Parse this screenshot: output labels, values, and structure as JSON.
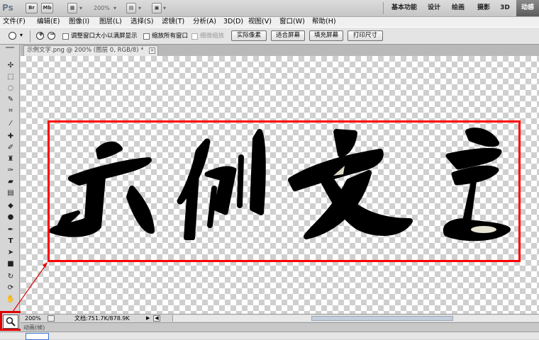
{
  "appbar": {
    "logo": "Ps",
    "br_label": "Br",
    "mb_label": "Mb",
    "zoom_value": "200%",
    "workspaces": [
      "基本功能",
      "设计",
      "绘画",
      "摄影",
      "3D",
      "动感"
    ],
    "active_workspace": "动感"
  },
  "menubar": {
    "items": [
      "文件(F)",
      "编辑(E)",
      "图像(I)",
      "图层(L)",
      "选择(S)",
      "滤镜(T)",
      "分析(A)",
      "3D(D)",
      "视图(V)",
      "窗口(W)",
      "帮助(H)"
    ]
  },
  "options": {
    "check_resize": "调整窗口大小以满屏显示",
    "check_zoom_all": "缩放所有窗口",
    "check_scrubby": "细微缩放",
    "btn_actual": "实际像素",
    "btn_fit": "适合屏幕",
    "btn_fill": "填充屏幕",
    "btn_print": "打印尺寸"
  },
  "document": {
    "tab_title": "示例文字.png @ 200% (图层 0, RGB/8) *",
    "close_label": "×"
  },
  "status": {
    "zoom": "200%",
    "doc_size": "文档:751.7K/878.9K"
  },
  "anim_panel": {
    "tab_label": "动画(帧)"
  },
  "colors": {
    "annotation_red": "#ff0000",
    "active_workspace_bg": "#6a6a6a",
    "canvas_checker": "#cfcfcf"
  },
  "icons": {
    "zoom_tool": "magnifier-icon",
    "tools": [
      "move-icon",
      "marquee-icon",
      "lasso-icon",
      "quick-select-icon",
      "crop-icon",
      "eyedropper-icon",
      "healing-icon",
      "brush-icon",
      "clone-stamp-icon",
      "history-brush-icon",
      "eraser-icon",
      "gradient-icon",
      "blur-icon",
      "dodge-icon",
      "pen-icon",
      "type-icon",
      "path-select-icon",
      "shape-icon",
      "3d-rotate-icon",
      "3d-orbit-icon",
      "hand-icon"
    ]
  }
}
